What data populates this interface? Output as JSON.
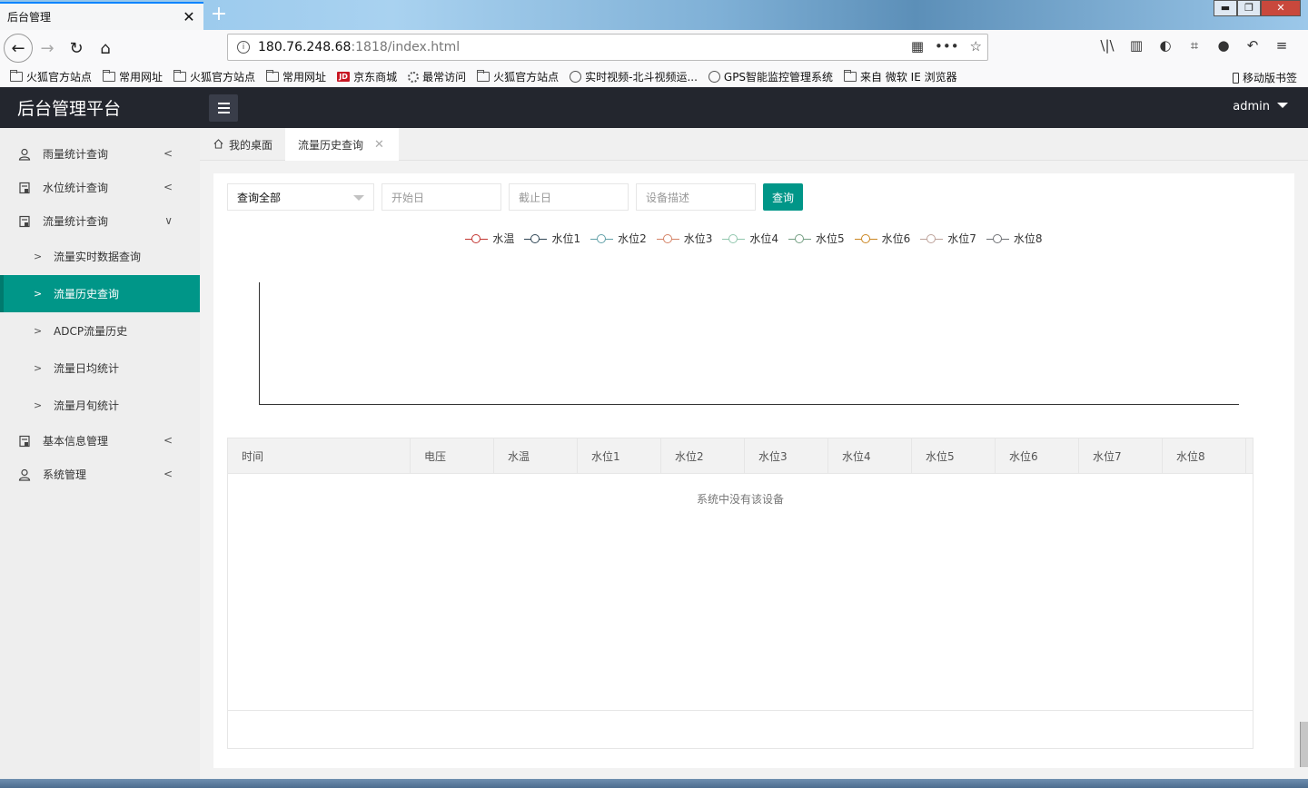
{
  "browser": {
    "tab_title": "后台管理",
    "tab_close": "✕",
    "new_tab": "+",
    "window_controls": {
      "minimize": "▬",
      "maximize": "❐",
      "close": "✕"
    },
    "url_host": "180.76.248.68",
    "url_rest": ":1818/index.html",
    "url_info": "i",
    "url_icons": {
      "qr": "▦",
      "more": "•••",
      "star": "☆"
    },
    "nav_icons": {
      "back": "←",
      "forward": "→",
      "reload": "↻",
      "home": "⌂"
    },
    "toolbar_icons": {
      "library": "\\|\\",
      "sidebar": "▥",
      "profile": "◐",
      "screenshot": "⌗",
      "chat": "●",
      "undo": "↶",
      "menu": "≡"
    },
    "bookmarks": [
      {
        "label": "火狐官方站点",
        "icon": "folder"
      },
      {
        "label": "常用网址",
        "icon": "folder"
      },
      {
        "label": "火狐官方站点",
        "icon": "folder"
      },
      {
        "label": "常用网址",
        "icon": "folder"
      },
      {
        "label": "京东商城",
        "icon": "jd",
        "badge": "JD"
      },
      {
        "label": "最常访问",
        "icon": "gear"
      },
      {
        "label": "火狐官方站点",
        "icon": "folder"
      },
      {
        "label": "实时视频-北斗视频运...",
        "icon": "globe"
      },
      {
        "label": "GPS智能监控管理系统",
        "icon": "globe"
      },
      {
        "label": "来自 微软 IE 浏览器",
        "icon": "folder"
      }
    ],
    "mobile_bookmarks": "移动版书签"
  },
  "app": {
    "title": "后台管理平台",
    "user": "admin"
  },
  "sidebar": {
    "items": [
      {
        "label": "雨量统计查询",
        "arrow": "<",
        "icon": "user-icon"
      },
      {
        "label": "水位统计查询",
        "arrow": "<",
        "icon": "doc-icon"
      },
      {
        "label": "流量统计查询",
        "arrow": "∨",
        "icon": "doc-icon"
      }
    ],
    "sub_items": [
      {
        "label": "流量实时数据查询",
        "active": false
      },
      {
        "label": "流量历史查询",
        "active": true
      },
      {
        "label": "ADCP流量历史",
        "active": false
      },
      {
        "label": "流量日均统计",
        "active": false
      },
      {
        "label": "流量月旬统计",
        "active": false
      }
    ],
    "items_after": [
      {
        "label": "基本信息管理",
        "arrow": "<",
        "icon": "doc-icon"
      },
      {
        "label": "系统管理",
        "arrow": "<",
        "icon": "user-icon"
      }
    ],
    "sub_caret": ">"
  },
  "tabs": {
    "home": "我的桌面",
    "active": "流量历史查询",
    "close": "✕"
  },
  "filters": {
    "select_value": "查询全部",
    "start_placeholder": "开始日",
    "end_placeholder": "截止日",
    "device_placeholder": "设备描述",
    "query_button": "查询"
  },
  "chart_data": {
    "type": "line",
    "series": [
      {
        "name": "水温",
        "color": "#c23531",
        "values": []
      },
      {
        "name": "水位1",
        "color": "#2f4554",
        "values": []
      },
      {
        "name": "水位2",
        "color": "#61a0a8",
        "values": []
      },
      {
        "name": "水位3",
        "color": "#d48265",
        "values": []
      },
      {
        "name": "水位4",
        "color": "#91c7ae",
        "values": []
      },
      {
        "name": "水位5",
        "color": "#749f83",
        "values": []
      },
      {
        "name": "水位6",
        "color": "#ca8622",
        "values": []
      },
      {
        "name": "水位7",
        "color": "#bda29a",
        "values": []
      },
      {
        "name": "水位8",
        "color": "#6e7074",
        "values": []
      }
    ],
    "x": [],
    "legend_position": "top-center",
    "grid": false
  },
  "table": {
    "columns": [
      "时间",
      "电压",
      "水温",
      "水位1",
      "水位2",
      "水位3",
      "水位4",
      "水位5",
      "水位6",
      "水位7",
      "水位8"
    ],
    "empty_message": "系统中没有该设备"
  },
  "colors": {
    "header_bg": "#23262e",
    "accent": "#009688",
    "sidebar_bg": "#eeeeee"
  }
}
